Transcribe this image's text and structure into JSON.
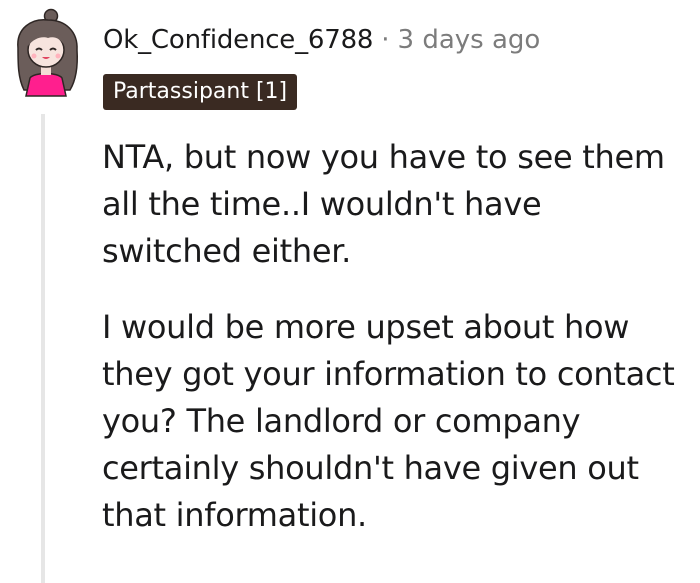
{
  "comment": {
    "author": "Ok_Confidence_6788",
    "separator": "·",
    "timestamp": "3 days ago",
    "flair": "Partassipant [1]",
    "paragraphs": [
      [
        "NTA, but now you have to see them",
        "all the time..I wouldn't have",
        "switched either."
      ],
      [
        "I would be more upset about how",
        "they got your information to contact",
        "you? The landlord or company",
        "certainly shouldn't have given out",
        "that information."
      ]
    ]
  },
  "colors": {
    "username": "#1a1a1b",
    "meta": "#7c7c7c",
    "flair_bg": "#3a2a22",
    "flair_text": "#ffffff",
    "thread_line": "#e6e6e6",
    "avatar_shirt": "#ff1f8e",
    "avatar_hair": "#6b5d5a"
  },
  "icons": {
    "avatar": "snoo-avatar-icon"
  }
}
